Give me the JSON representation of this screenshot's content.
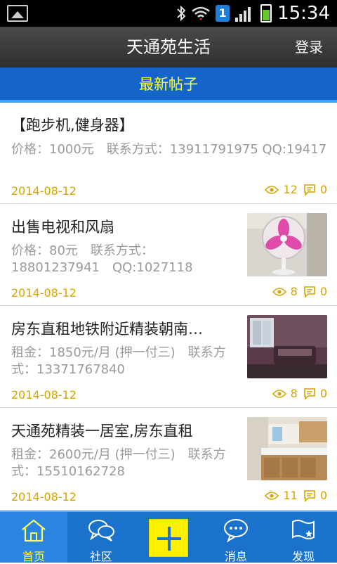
{
  "status": {
    "time": "15:34",
    "sim_label": "1",
    "icons": [
      "gallery-icon",
      "bluetooth-icon",
      "wifi-icon",
      "sim-icon",
      "signal-icon",
      "battery-icon"
    ]
  },
  "header": {
    "title": "天通苑生活",
    "login_label": "登录"
  },
  "section": {
    "title": "最新帖子"
  },
  "posts": [
    {
      "title": "【跑步机,健身器】",
      "desc": "价格：1000元　联系方式：13911791975 QQ:19417",
      "date": "2014-08-12",
      "views": "12",
      "comments": "0",
      "has_image": false
    },
    {
      "title": "出售电视和风扇",
      "desc": "价格：80元　联系方式：18801237941　QQ:1027118",
      "date": "2014-08-12",
      "views": "8",
      "comments": "0",
      "has_image": true,
      "image_subject": "pink-electric-fan"
    },
    {
      "title": "房东直租地铁附近精装朝南…",
      "desc": "租金：1850元/月 (押一付三)　联系方式：13371767840",
      "date": "2014-08-12",
      "views": "8",
      "comments": "0",
      "has_image": true,
      "image_subject": "bedroom-with-sofa"
    },
    {
      "title": "天通苑精装一居室,房东直租",
      "desc": "租金：2600元/月 (押一付三)　联系方式：15510162728",
      "date": "2014-08-12",
      "views": "11",
      "comments": "0",
      "has_image": true,
      "image_subject": "kitchen"
    }
  ],
  "tabs": [
    {
      "label": "首页",
      "icon": "home-icon",
      "active": true
    },
    {
      "label": "社区",
      "icon": "chat-bubbles-icon",
      "active": false
    },
    {
      "label": "",
      "icon": "plus-icon",
      "active": false
    },
    {
      "label": "消息",
      "icon": "message-icon",
      "active": false
    },
    {
      "label": "发现",
      "icon": "discover-flag-icon",
      "active": false
    }
  ],
  "colors": {
    "accent_blue": "#1565c8",
    "highlight_yellow": "#ffff33",
    "date_gold": "#d6a400",
    "appbar_dark": "#3a3a3a"
  }
}
